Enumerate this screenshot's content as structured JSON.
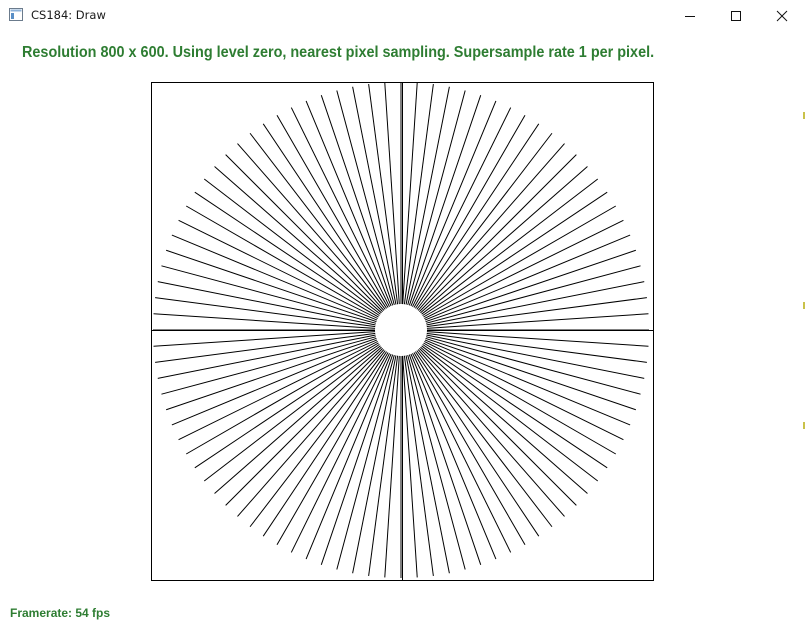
{
  "window": {
    "title": "CS184: Draw",
    "icons": {
      "app": "app-window-icon",
      "minimize": "minimize-icon",
      "maximize": "maximize-icon",
      "close": "close-icon"
    }
  },
  "status": {
    "text": "Resolution 800 x 600. Using level zero, nearest pixel sampling. Supersample rate 1 per pixel.",
    "color": "#2e7d32"
  },
  "framerate": {
    "text": "Framerate: 54 fps"
  },
  "drawing": {
    "description_type": "starburst",
    "line_count": 96,
    "line_color": "#000000",
    "background": "#ffffff"
  }
}
